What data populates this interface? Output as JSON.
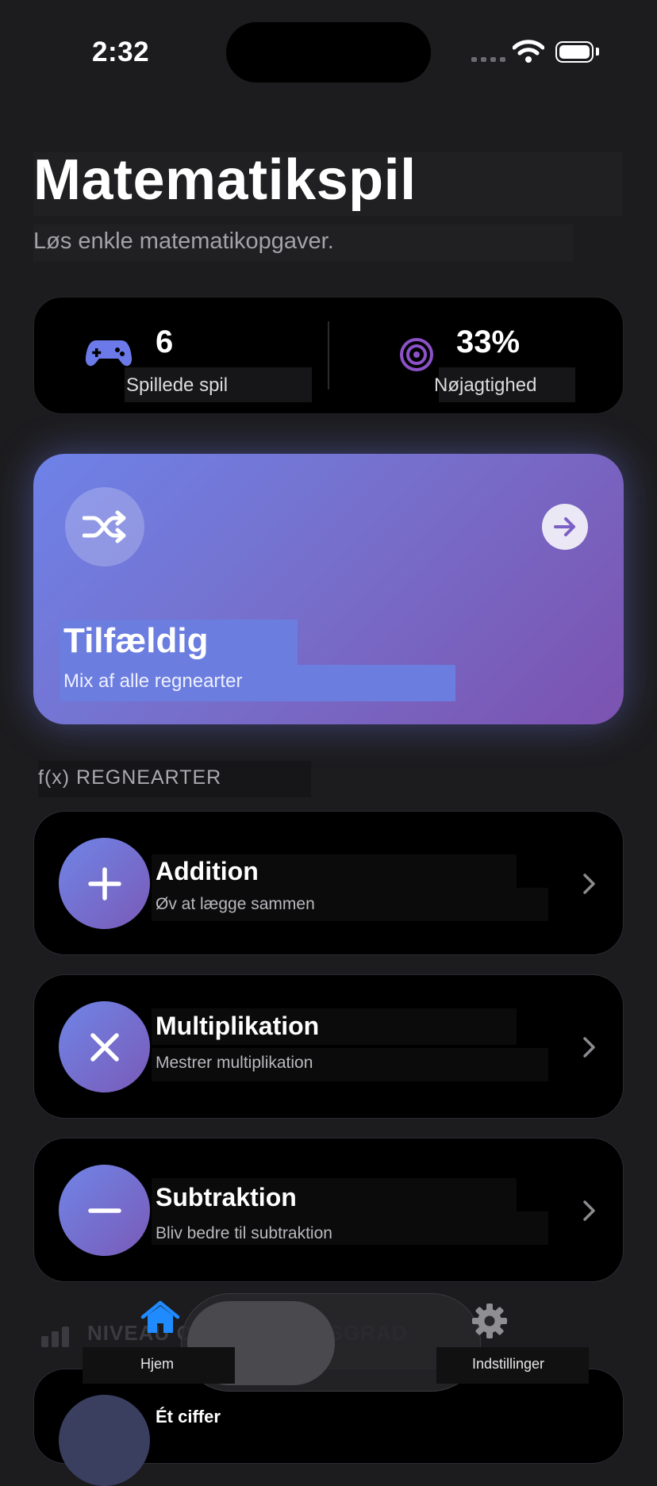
{
  "status_bar": {
    "time": "2:32"
  },
  "header": {
    "title": "Matematikspil",
    "subtitle": "Løs enkle matematikopgaver."
  },
  "stats": [
    {
      "icon": "gamepad-icon",
      "value": "6",
      "label": "Spillede spil",
      "color": "#6b7ae8"
    },
    {
      "icon": "target-icon",
      "value": "33%",
      "label": "Nøjagtighed",
      "color": "#8b52c8"
    }
  ],
  "random_card": {
    "title": "Tilfældig",
    "subtitle": "Mix af alle regnearter",
    "icon": "shuffle-icon",
    "action_icon": "arrow-right-icon"
  },
  "section_operations": {
    "label": "f(x) REGNEARTER"
  },
  "operations": [
    {
      "symbol": "plus-icon",
      "title": "Addition",
      "subtitle": "Øv at lægge sammen"
    },
    {
      "symbol": "times-icon",
      "title": "Multiplikation",
      "subtitle": "Mestrer multiplikation"
    },
    {
      "symbol": "minus-icon",
      "title": "Subtraktion",
      "subtitle": "Bliv bedre til subtraktion"
    }
  ],
  "section_level": {
    "label": "NIVEAU OG SVÆRHEDSGRAD"
  },
  "level_items": [
    {
      "title": "Ét ciffer"
    }
  ],
  "tab_bar": {
    "tabs": [
      {
        "label": "Hjem",
        "icon": "house-icon",
        "active": true
      },
      {
        "label": "Indstillinger",
        "icon": "gear-icon",
        "active": false
      }
    ],
    "accent": "#1f8bff"
  }
}
